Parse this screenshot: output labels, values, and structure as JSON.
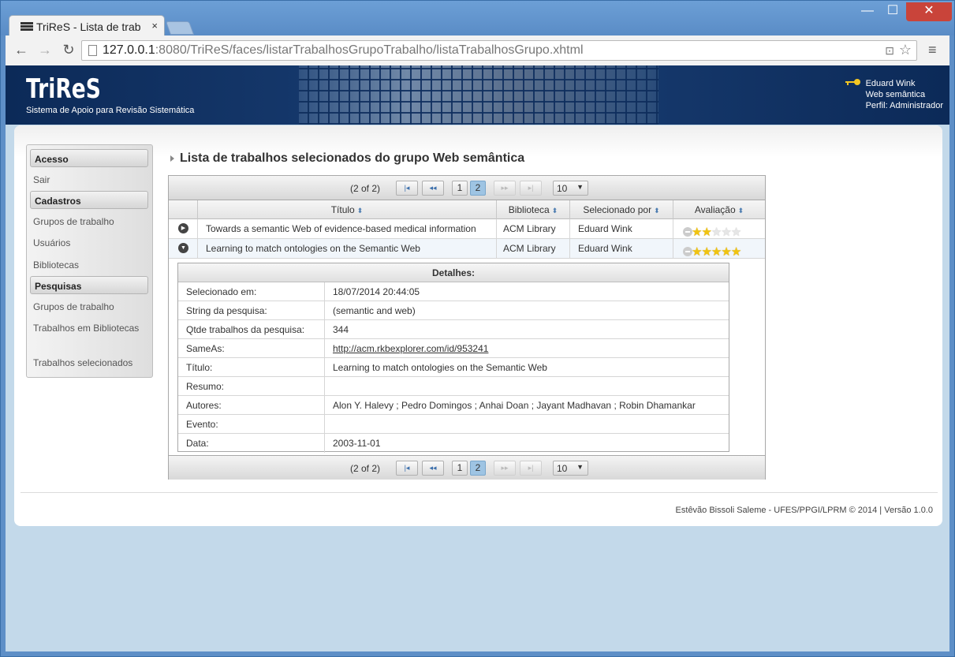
{
  "browser": {
    "tab_title": "TriReS - Lista de trab",
    "tab_close": "×",
    "url_host": "127.0.0.1",
    "url_rest": ":8080/TriReS/faces/listarTrabalhosGrupoTrabalho/listaTrabalhosGrupo.xhtml",
    "win_min": "—",
    "win_max": "☐",
    "win_close": "✕",
    "back_icon": "←",
    "forward_icon": "→",
    "reload_icon": "↻",
    "menu_icon": "≡",
    "star_icon": "☆",
    "translate_icon": "⊡"
  },
  "header": {
    "logo_title": "TriReS",
    "logo_subtitle": "Sistema de Apoio para Revisão Sistemática",
    "user_name": "Eduard Wink",
    "user_group": "Web semântica",
    "user_profile": "Perfil: Administrador"
  },
  "sidebar": {
    "sections": [
      {
        "title": "Acesso",
        "items": [
          "Sair"
        ]
      },
      {
        "title": "Cadastros",
        "items": [
          "Grupos de trabalho",
          "Usuários",
          "Bibliotecas"
        ]
      },
      {
        "title": "Pesquisas",
        "items": [
          "Grupos de trabalho",
          "Trabalhos em Bibliotecas",
          "Trabalhos selecionados"
        ]
      }
    ]
  },
  "main": {
    "title": "Lista de trabalhos selecionados do grupo Web semântica",
    "paginator": {
      "status": "(2 of 2)",
      "first": "◂◂",
      "prev": "◂◂",
      "next": "▸▸",
      "last": "▸▸",
      "pages": [
        "1",
        "2"
      ],
      "current_page": "2",
      "rows_per_page": "10",
      "caret": "▼"
    },
    "table": {
      "columns": [
        "Título",
        "Biblioteca",
        "Selecionado por",
        "Avaliação"
      ],
      "sort_icon": "⬍",
      "rows": [
        {
          "title": "Towards a semantic Web of evidence-based medical information",
          "library": "ACM Library",
          "selected_by": "Eduard Wink",
          "rating": 2,
          "expanded": false,
          "expander": "▶"
        },
        {
          "title": "Learning to match ontologies on the Semantic Web",
          "library": "ACM Library",
          "selected_by": "Eduard Wink",
          "rating": 5,
          "expanded": true,
          "expander": "▼"
        }
      ]
    },
    "details": {
      "header": "Detalhes:",
      "fields": [
        {
          "label": "Selecionado em:",
          "value": "18/07/2014 20:44:05"
        },
        {
          "label": "String da pesquisa:",
          "value": "(semantic and web)"
        },
        {
          "label": "Qtde trabalhos da pesquisa:",
          "value": "344"
        },
        {
          "label": "SameAs:",
          "value": "http://acm.rkbexplorer.com/id/953241"
        },
        {
          "label": "Título:",
          "value": "Learning to match ontologies on the Semantic Web"
        },
        {
          "label": "Resumo:",
          "value": ""
        },
        {
          "label": "Autores:",
          "value": "Alon Y. Halevy ; Pedro Domingos ; Anhai Doan ; Jayant Madhavan ; Robin Dhamankar"
        },
        {
          "label": "Evento:",
          "value": ""
        },
        {
          "label": "Data:",
          "value": "2003-11-01"
        }
      ]
    }
  },
  "footer": {
    "text": "Estêvão Bissoli Saleme - UFES/PPGI/LPRM © 2014 | Versão 1.0.0"
  },
  "colors": {
    "header_bg": "#0c2a58",
    "active_page": "#9ec4e3",
    "star_on": "#f1c40f",
    "window_frame": "#5e8fc7"
  }
}
